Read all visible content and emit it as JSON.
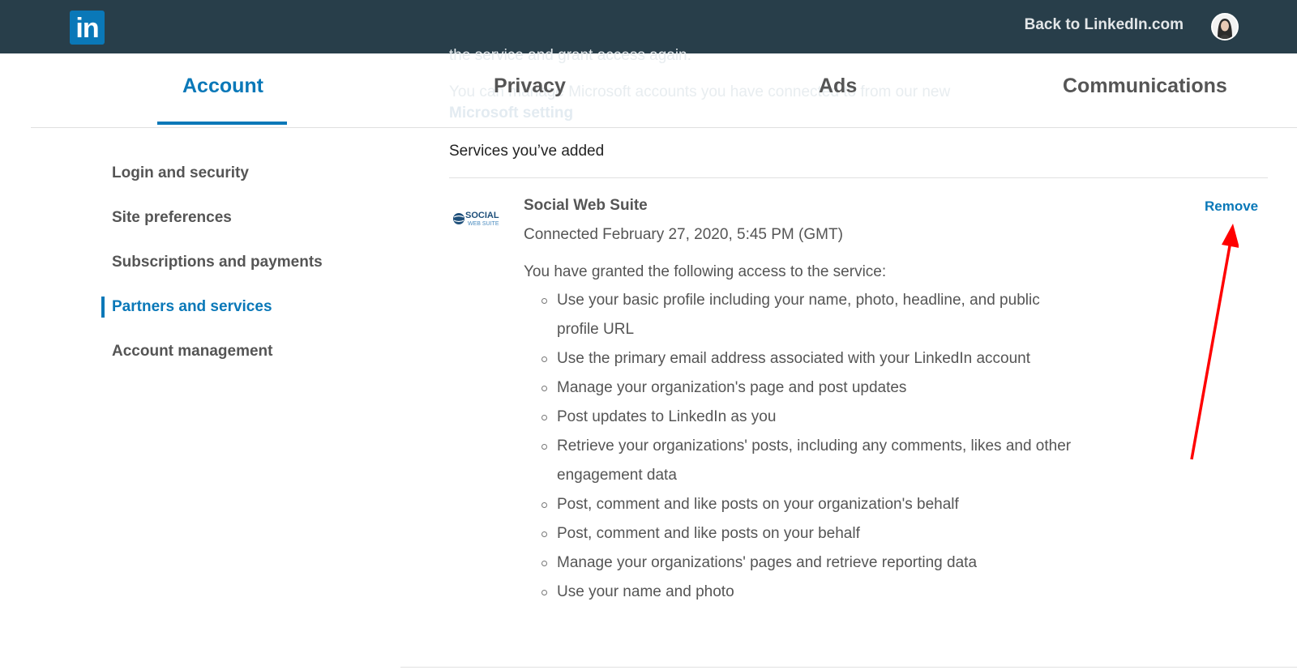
{
  "topbar": {
    "logo_text": "in",
    "back_link": "Back to LinkedIn.com",
    "colors": {
      "bar": "#283e4a",
      "brand": "#0a78b8"
    }
  },
  "ghost_text": {
    "line1": "the service and grant access again.",
    "line2": "You can manage Microsoft accounts you have connected to from our new",
    "line3": "Microsoft setting"
  },
  "tabs": [
    {
      "label": "Account",
      "active": true
    },
    {
      "label": "Privacy",
      "active": false
    },
    {
      "label": "Ads",
      "active": false
    },
    {
      "label": "Communications",
      "active": false
    }
  ],
  "sidebar": {
    "items": [
      {
        "label": "Login and security",
        "active": false
      },
      {
        "label": "Site preferences",
        "active": false
      },
      {
        "label": "Subscriptions and payments",
        "active": false
      },
      {
        "label": "Partners and services",
        "active": true
      },
      {
        "label": "Account management",
        "active": false
      }
    ]
  },
  "main": {
    "section_title": "Services you’ve added",
    "service": {
      "logo_text_top": "SOCIAL",
      "logo_text_bottom": "WEB SUITE",
      "name": "Social Web Suite",
      "connected": "Connected February 27, 2020, 5:45 PM (GMT)",
      "remove_label": "Remove",
      "access_intro": "You have granted the following access to the service:",
      "access_items": [
        "Use your basic profile including your name, photo, headline, and public profile URL",
        "Use the primary email address associated with your LinkedIn account",
        "Manage your organization's page and post updates",
        "Post updates to LinkedIn as you",
        "Retrieve your organizations' posts, including any comments, likes and other engagement data",
        "Post, comment and like posts on your organization's behalf",
        "Post, comment and like posts on your behalf",
        "Manage your organizations' pages and retrieve reporting data",
        "Use your name and photo"
      ]
    }
  },
  "annotation": {
    "arrow_color": "#ff0000"
  }
}
